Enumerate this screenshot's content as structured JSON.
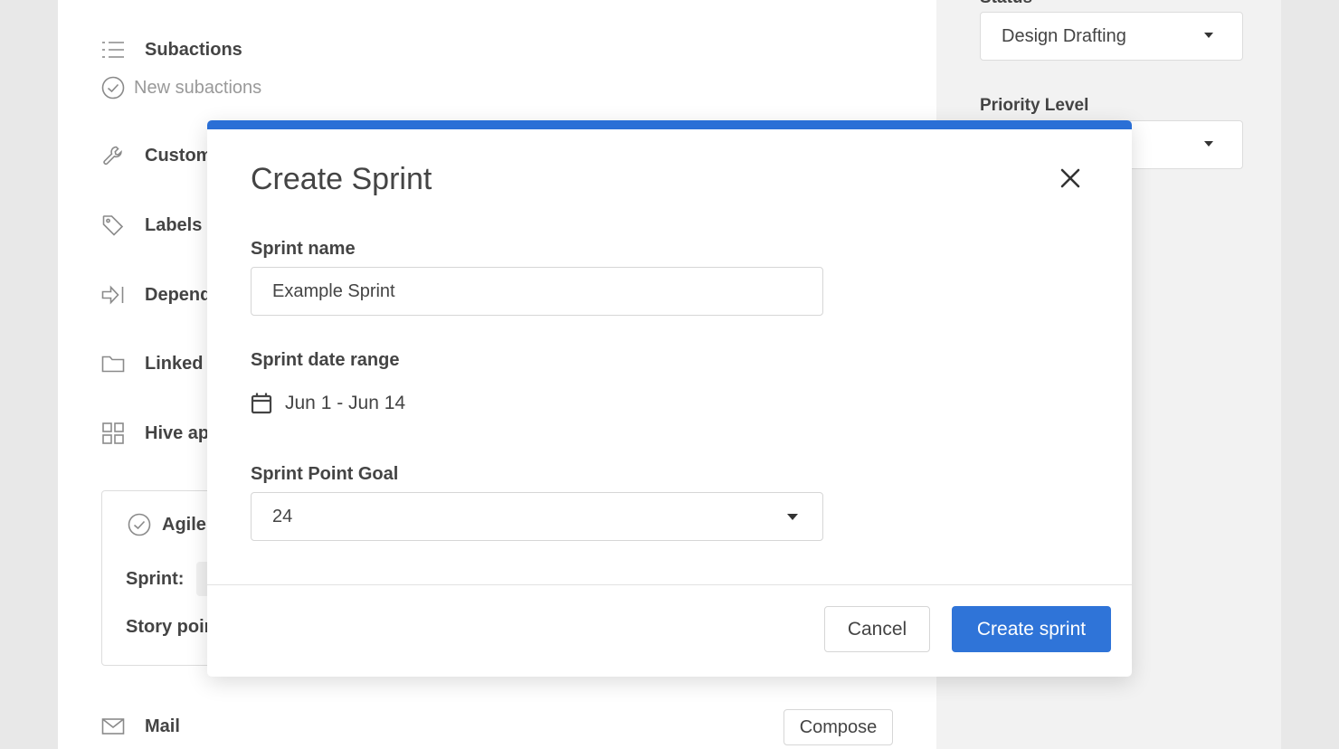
{
  "colors": {
    "accent": "#2f74d8",
    "modal_bar": "#2a6fd6"
  },
  "sidebar": {
    "subactions_label": "Subactions",
    "new_subactions_placeholder": "New subactions",
    "items": [
      {
        "label": "Custom",
        "icon": "wrench-icon"
      },
      {
        "label": "Labels",
        "icon": "tag-icon"
      },
      {
        "label": "Dependencies",
        "icon": "dependency-arrow-icon"
      },
      {
        "label": "Linked",
        "icon": "folder-icon"
      },
      {
        "label": "Hive apps",
        "icon": "grid-icon"
      }
    ],
    "agile": {
      "title": "Agile",
      "sprint_label": "Sprint:",
      "story_points_label": "Story points"
    },
    "mail_label": "Mail",
    "compose_label": "Compose"
  },
  "right_panel": {
    "status_label": "Status",
    "status_value": "Design Drafting",
    "priority_label": "Priority Level",
    "priority_value": ""
  },
  "modal": {
    "title": "Create Sprint",
    "sprint_name_label": "Sprint name",
    "sprint_name_value": "Example Sprint",
    "date_range_label": "Sprint date range",
    "date_range_value": "Jun 1 - Jun 14",
    "point_goal_label": "Sprint Point Goal",
    "point_goal_value": "24",
    "cancel_label": "Cancel",
    "create_label": "Create sprint"
  }
}
